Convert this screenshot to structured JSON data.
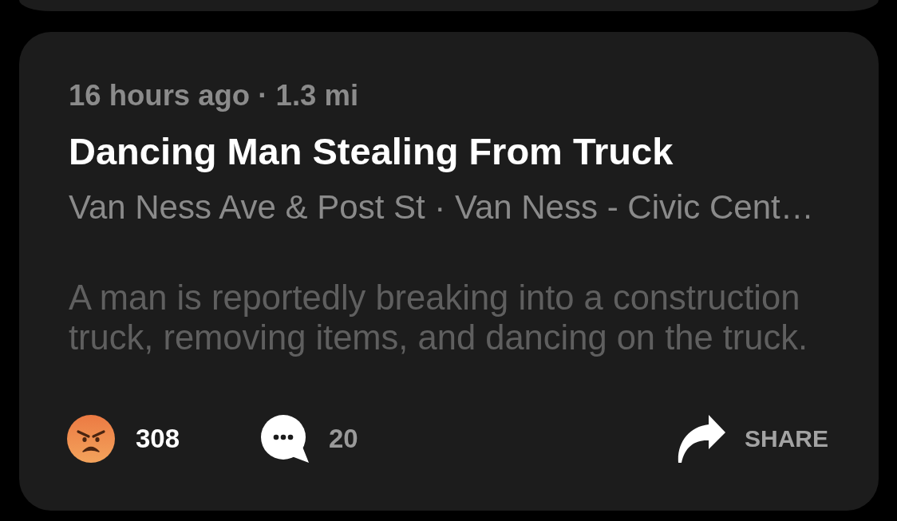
{
  "post": {
    "meta": "16 hours ago · 1.3 mi",
    "title": "Dancing Man Stealing From Truck",
    "location": "Van Ness Ave & Post St · Van Ness - Civic Cent…",
    "description": "A man is reportedly breaking into a construction truck, removing items, and dancing on the truck.",
    "actions": [
      {
        "kind": "reaction",
        "label": "308"
      },
      {
        "kind": "comments",
        "label": "20"
      },
      {
        "kind": "share",
        "label": "SHARE"
      }
    ]
  }
}
